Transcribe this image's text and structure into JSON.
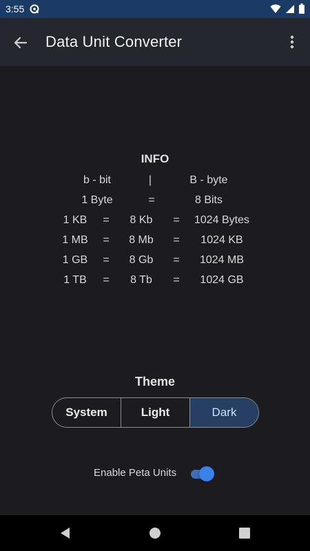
{
  "status_bar": {
    "time": "3:55",
    "icons": [
      "app-notification-icon",
      "wifi-icon",
      "signal-icon",
      "battery-icon"
    ]
  },
  "app_bar": {
    "title": "Data Unit Converter",
    "back_icon": "arrow-back-icon",
    "menu_icon": "more-vertical-icon"
  },
  "info": {
    "title": "INFO",
    "legend": {
      "left": "b - bit",
      "separator": "|",
      "right": "B - byte"
    },
    "byte_row": {
      "left": "1 Byte",
      "eq": "=",
      "right": "8 Bits"
    },
    "rows": [
      {
        "unit": "1 KB",
        "eq1": "=",
        "bits": "8 Kb",
        "eq2": "=",
        "bytes": "1024 Bytes"
      },
      {
        "unit": "1 MB",
        "eq1": "=",
        "bits": "8 Mb",
        "eq2": "=",
        "bytes": "1024 KB"
      },
      {
        "unit": "1 GB",
        "eq1": "=",
        "bits": "8 Gb",
        "eq2": "=",
        "bytes": "1024 MB"
      },
      {
        "unit": "1 TB",
        "eq1": "=",
        "bits": "8 Tb",
        "eq2": "=",
        "bytes": "1024 GB"
      }
    ]
  },
  "theme": {
    "title": "Theme",
    "options": [
      "System",
      "Light",
      "Dark"
    ],
    "selected": "Dark"
  },
  "peta": {
    "label": "Enable Peta Units",
    "enabled": true
  },
  "colors": {
    "status_bar": "#1b3a66",
    "app_bar": "#25272f",
    "background": "#1c1c20",
    "accent": "#3b82e8",
    "selected_segment": "#263f63"
  }
}
